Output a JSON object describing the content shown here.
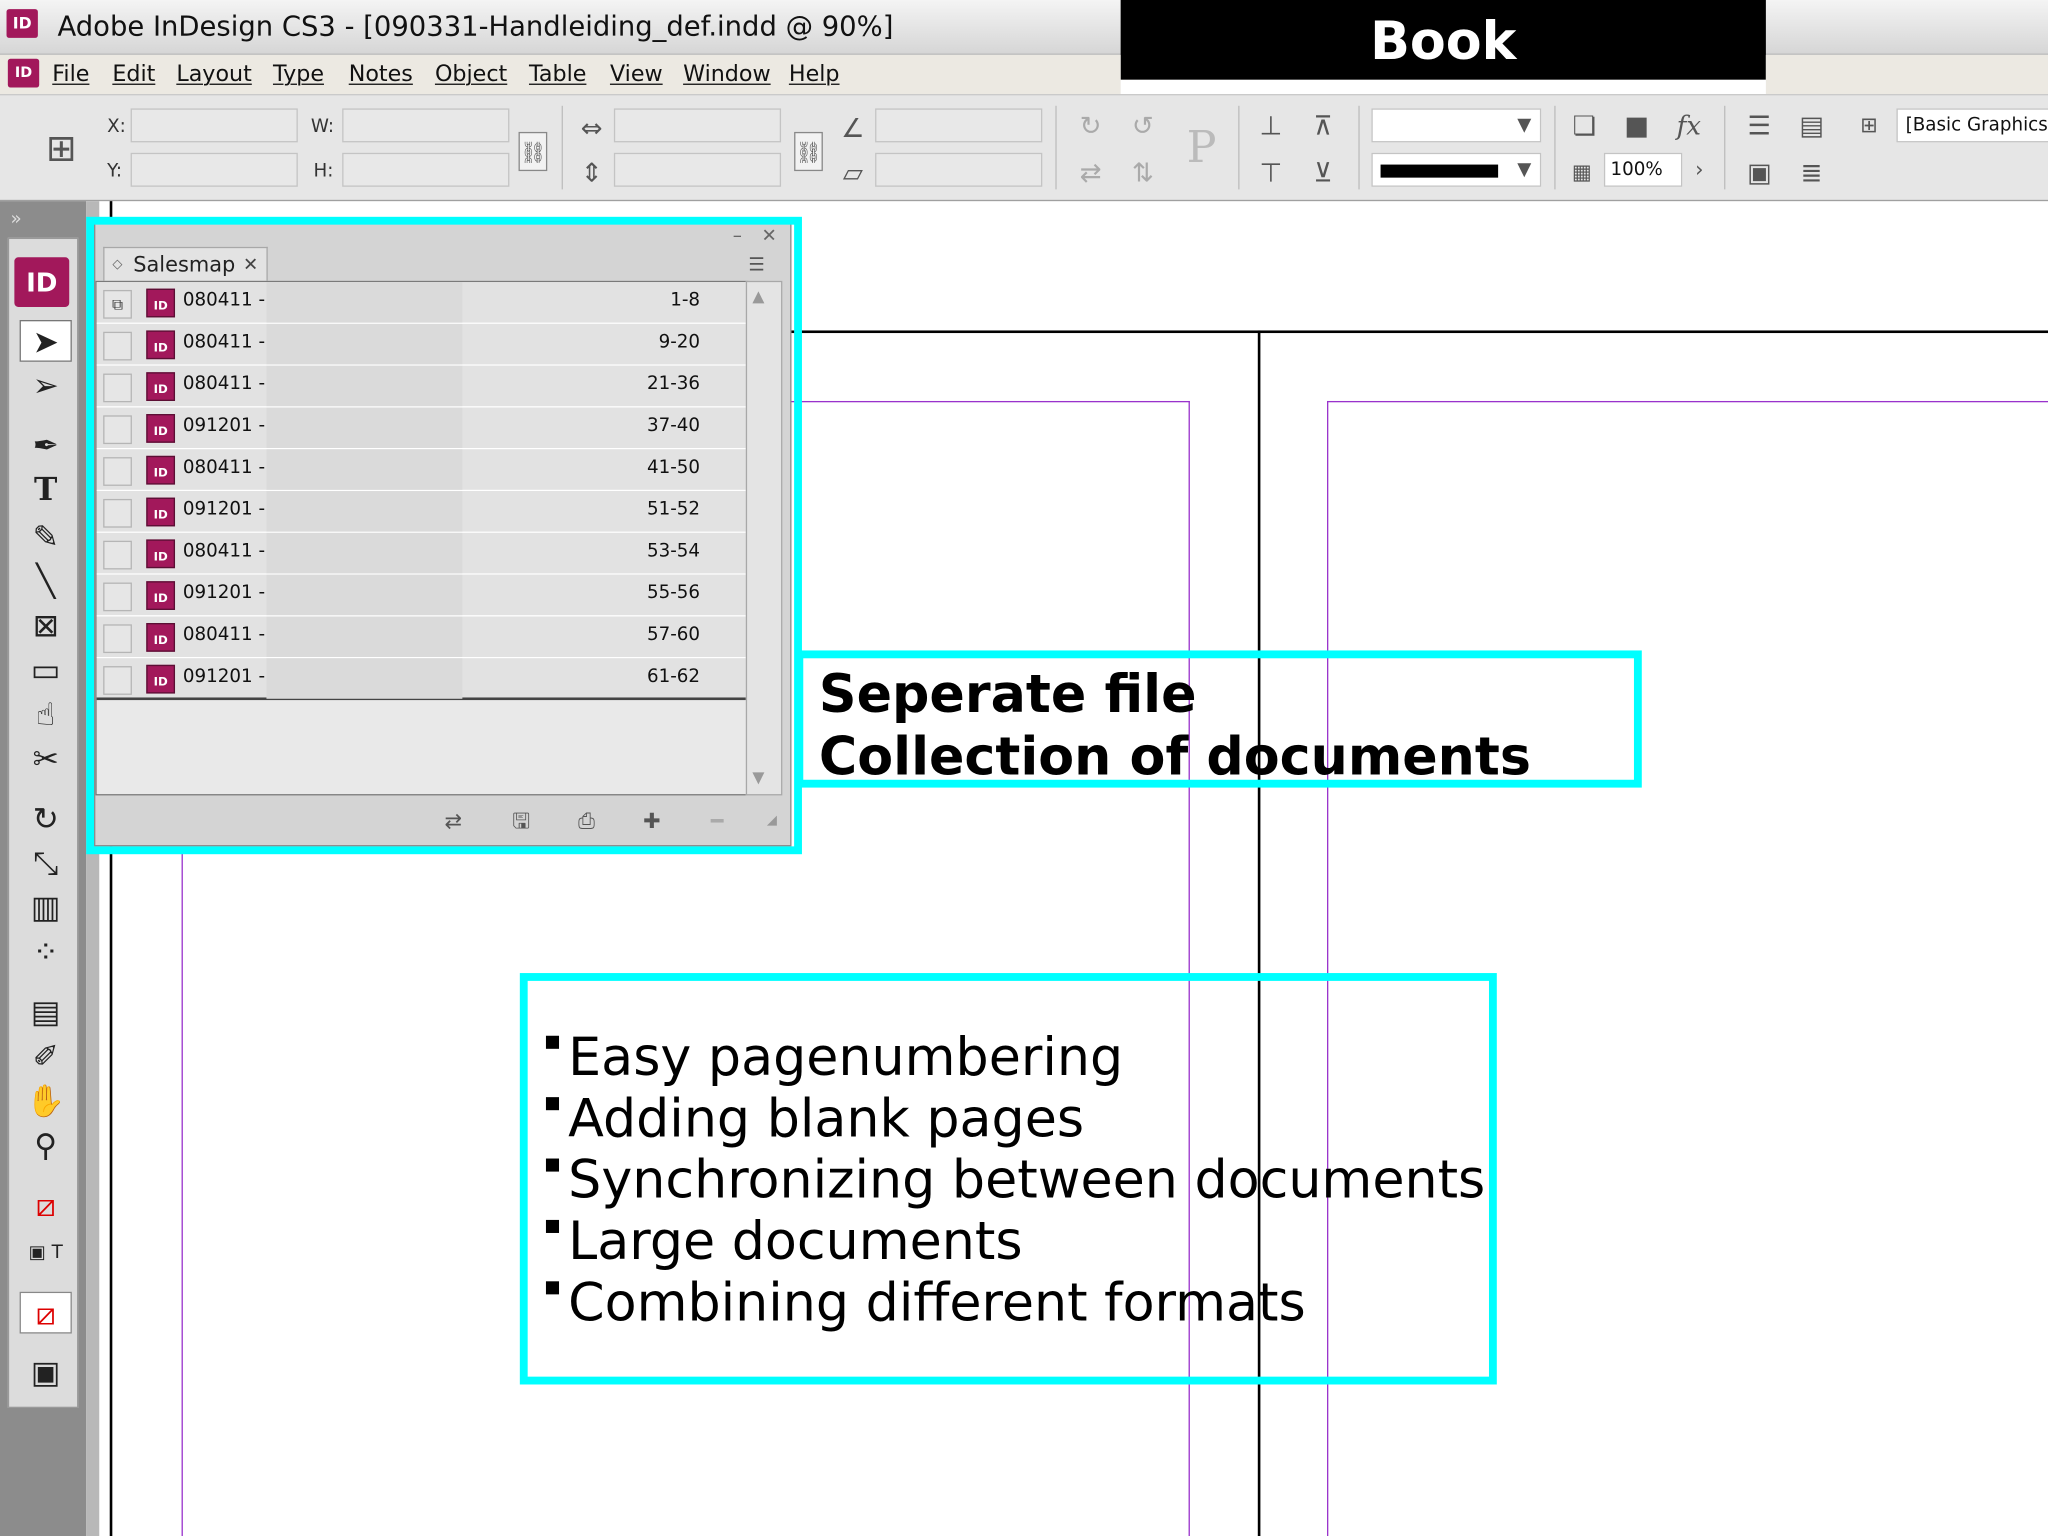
{
  "window": {
    "title": "Adobe InDesign CS3 - [090331-Handleiding_def.indd @ 90%]",
    "app_icon": "ID"
  },
  "slide_banner": "Book",
  "menu": {
    "logo": "ID",
    "items": [
      "File",
      "Edit",
      "Layout",
      "Type",
      "Notes",
      "Object",
      "Table",
      "View",
      "Window",
      "Help"
    ]
  },
  "control_panel": {
    "x_label": "X:",
    "y_label": "Y:",
    "w_label": "W:",
    "h_label": "H:",
    "opacity": "100%",
    "object_style": "[Basic Graphics F"
  },
  "book_panel": {
    "tab_label": "Salesmap",
    "documents": [
      {
        "name": "080411 - :",
        "pages": "1-8"
      },
      {
        "name": "080411 - :",
        "pages": "9-20"
      },
      {
        "name": "080411 - :",
        "pages": "21-36"
      },
      {
        "name": "091201 - '",
        "pages": "37-40"
      },
      {
        "name": "080411 - :",
        "pages": "41-50"
      },
      {
        "name": "091201 - '",
        "pages": "51-52"
      },
      {
        "name": "080411 - :",
        "pages": "53-54"
      },
      {
        "name": "091201 - '",
        "pages": "55-56"
      },
      {
        "name": "080411 - :",
        "pages": "57-60"
      },
      {
        "name": "091201 - '",
        "pages": "61-62"
      }
    ],
    "doc_icon_label": "ID"
  },
  "annotation_box": {
    "line1": "Seperate file",
    "line2": "Collection of documents"
  },
  "benefits": [
    "Easy pagenumbering",
    "Adding blank pages",
    "Synchronizing between documents",
    "Large documents",
    "Combining different formats"
  ],
  "colors": {
    "highlight": "#00ffff",
    "indesign_brand": "#a2185b",
    "guide": "#9933cc"
  }
}
